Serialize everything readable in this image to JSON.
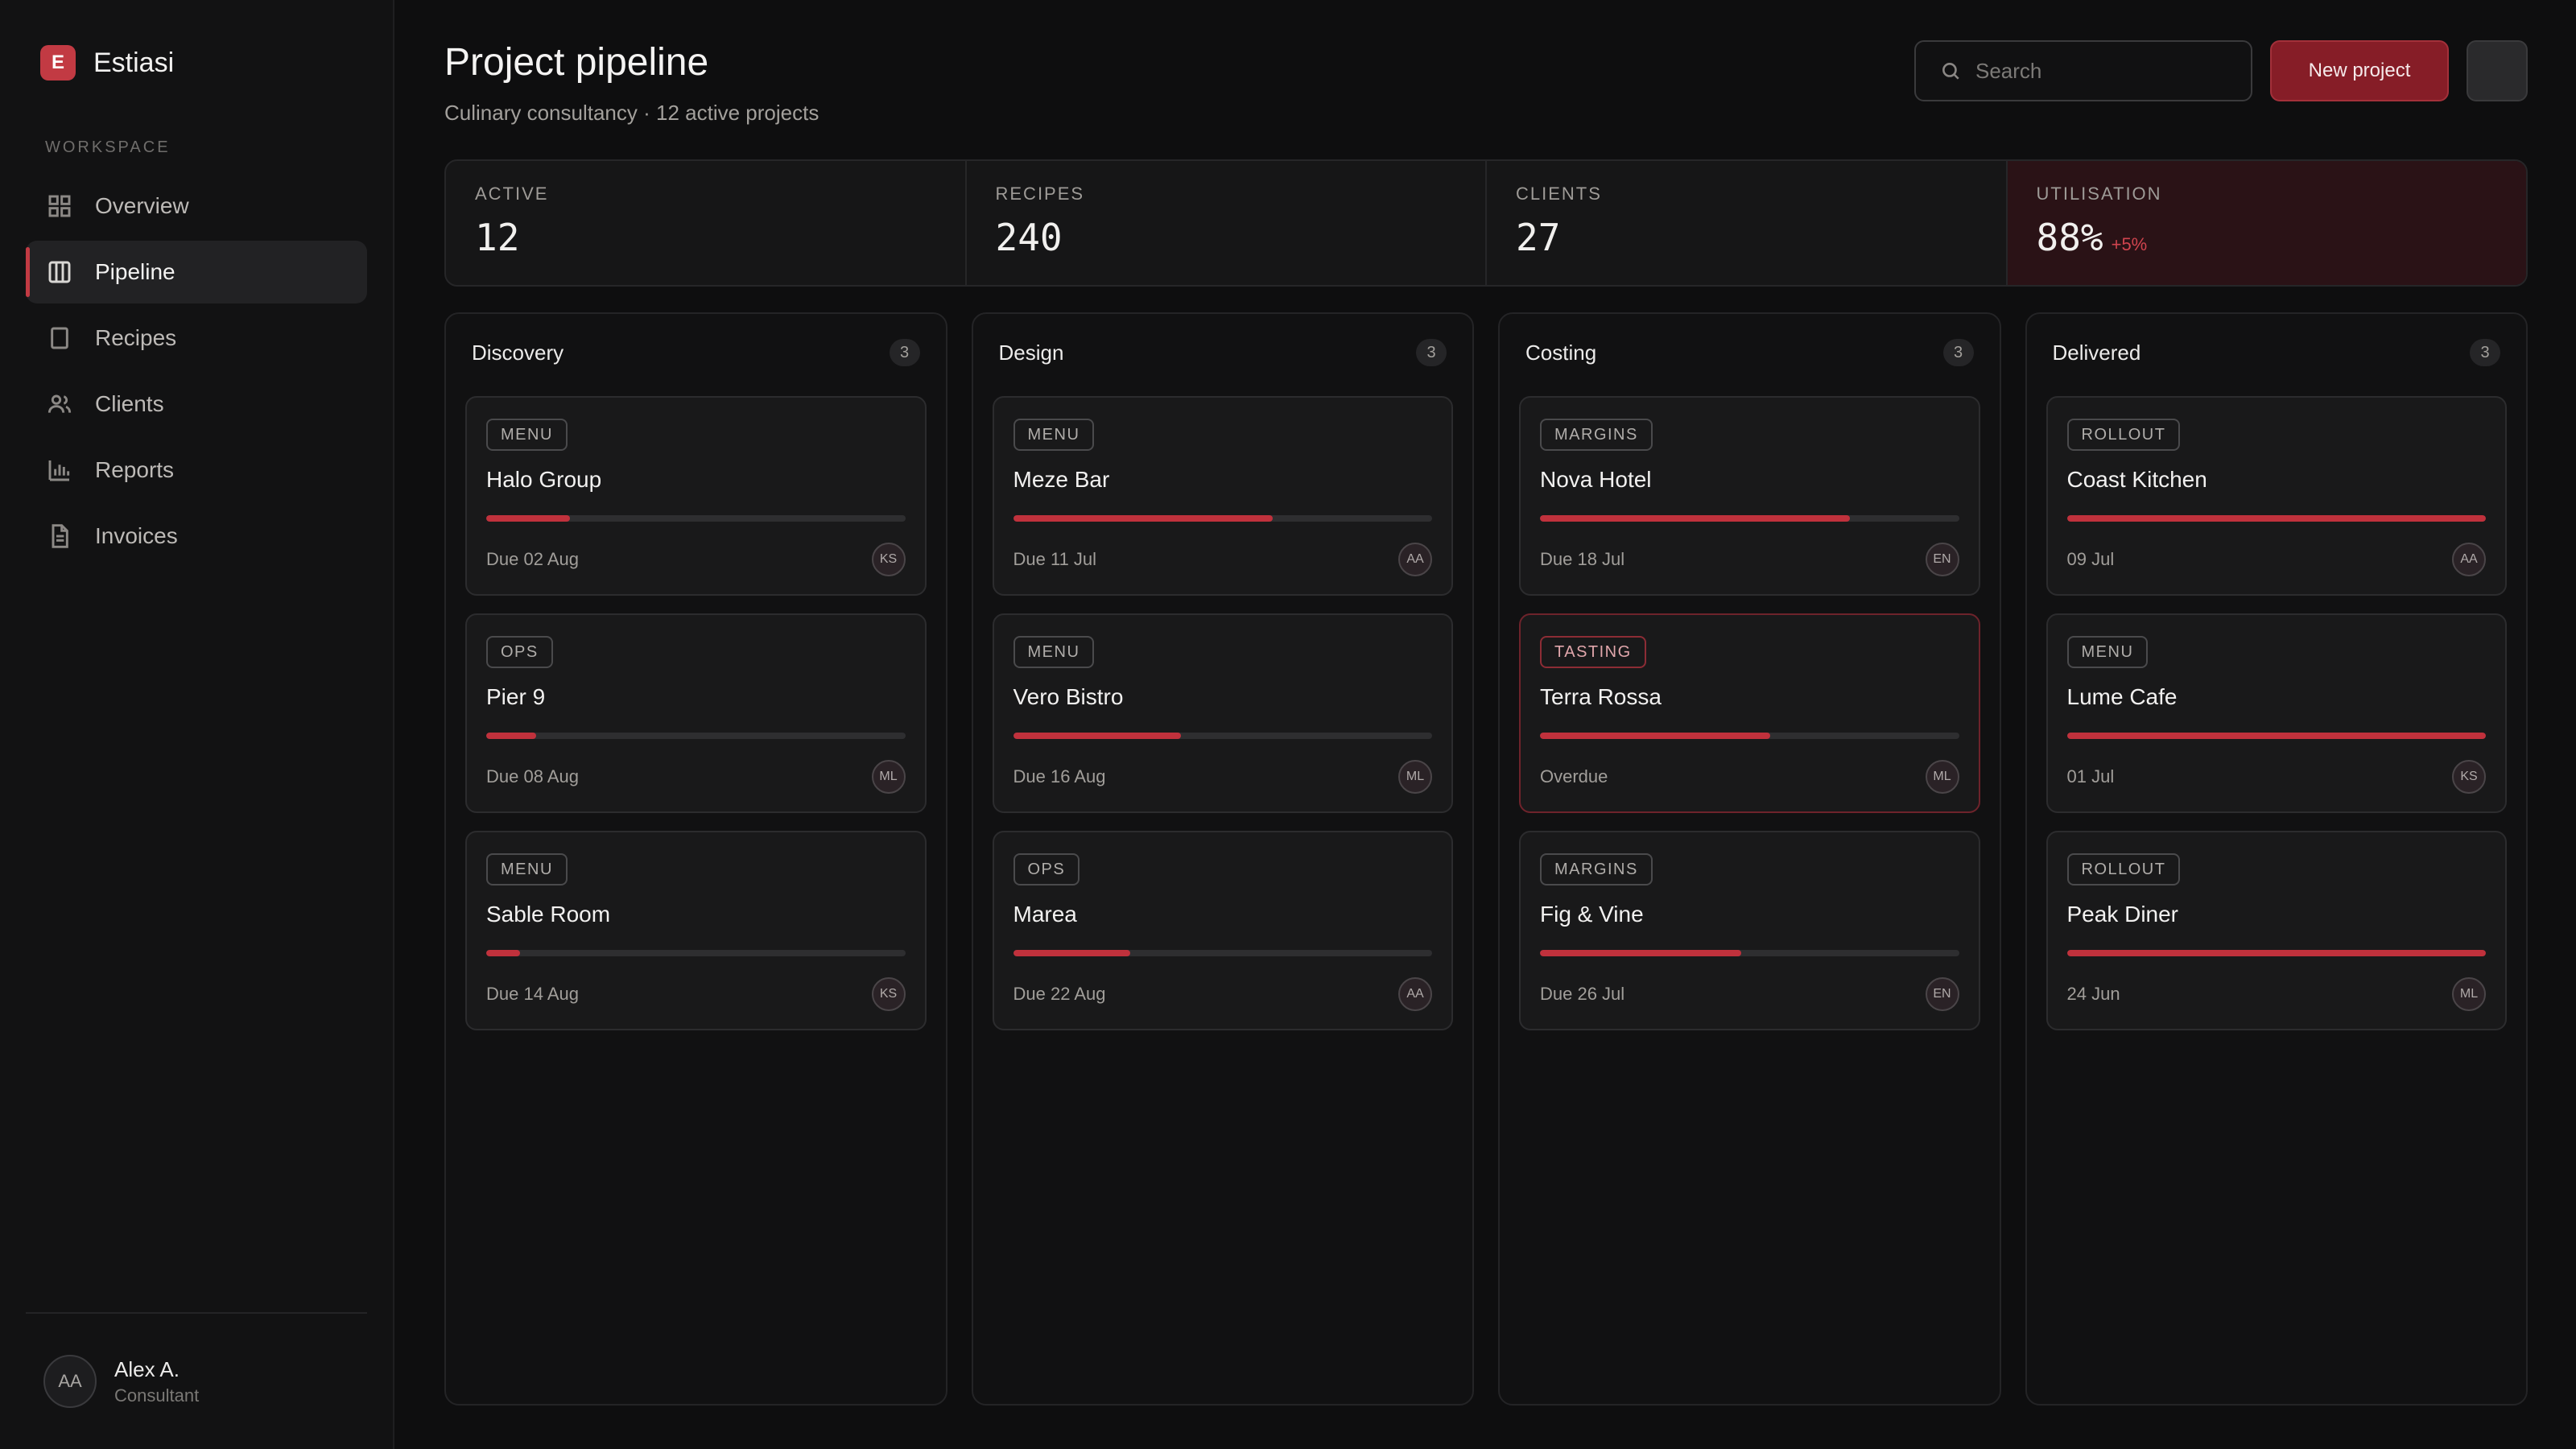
{
  "brand": {
    "logo_letter": "E",
    "name": "Estiasi"
  },
  "sidebar": {
    "section": "WORKSPACE",
    "items": [
      {
        "label": "Overview",
        "icon": "grid-icon",
        "active": false
      },
      {
        "label": "Pipeline",
        "icon": "columns-icon",
        "active": true
      },
      {
        "label": "Recipes",
        "icon": "book-icon",
        "active": false
      },
      {
        "label": "Clients",
        "icon": "users-icon",
        "active": false
      },
      {
        "label": "Reports",
        "icon": "bar-chart-icon",
        "active": false
      },
      {
        "label": "Invoices",
        "icon": "file-icon",
        "active": false
      }
    ],
    "user": {
      "initials": "AA",
      "name": "Alex A.",
      "role": "Consultant"
    }
  },
  "header": {
    "title": "Project pipeline",
    "subtitle": "Culinary consultancy · 12 active projects",
    "search_placeholder": "Search",
    "new_button": "New project"
  },
  "stats": [
    {
      "label": "ACTIVE",
      "value": "12",
      "delta": ""
    },
    {
      "label": "RECIPES",
      "value": "240",
      "delta": ""
    },
    {
      "label": "CLIENTS",
      "value": "27",
      "delta": ""
    },
    {
      "label": "UTILISATION",
      "value": "88%",
      "delta": "+5%"
    }
  ],
  "columns": [
    {
      "title": "Discovery",
      "count": "3",
      "cards": [
        {
          "tag": "MENU",
          "title": "Halo Group",
          "progress": 0.2,
          "due": "Due 02 Aug",
          "assignee": "KS",
          "alert": false
        },
        {
          "tag": "OPS",
          "title": "Pier 9",
          "progress": 0.12,
          "due": "Due 08 Aug",
          "assignee": "ML",
          "alert": false
        },
        {
          "tag": "MENU",
          "title": "Sable Room",
          "progress": 0.08,
          "due": "Due 14 Aug",
          "assignee": "KS",
          "alert": false
        }
      ]
    },
    {
      "title": "Design",
      "count": "3",
      "cards": [
        {
          "tag": "MENU",
          "title": "Meze Bar",
          "progress": 0.62,
          "due": "Due 11 Jul",
          "assignee": "AA",
          "alert": false
        },
        {
          "tag": "MENU",
          "title": "Vero Bistro",
          "progress": 0.4,
          "due": "Due 16 Aug",
          "assignee": "ML",
          "alert": false
        },
        {
          "tag": "OPS",
          "title": "Marea",
          "progress": 0.28,
          "due": "Due 22 Aug",
          "assignee": "AA",
          "alert": false
        }
      ]
    },
    {
      "title": "Costing",
      "count": "3",
      "cards": [
        {
          "tag": "MARGINS",
          "title": "Nova Hotel",
          "progress": 0.74,
          "due": "Due 18 Jul",
          "assignee": "EN",
          "alert": false
        },
        {
          "tag": "TASTING",
          "title": "Terra Rossa",
          "progress": 0.55,
          "due": "Overdue",
          "assignee": "ML",
          "alert": true
        },
        {
          "tag": "MARGINS",
          "title": "Fig & Vine",
          "progress": 0.48,
          "due": "Due 26 Jul",
          "assignee": "EN",
          "alert": false
        }
      ]
    },
    {
      "title": "Delivered",
      "count": "3",
      "cards": [
        {
          "tag": "ROLLOUT",
          "title": "Coast Kitchen",
          "progress": 1.0,
          "due": "09 Jul",
          "assignee": "AA",
          "alert": false
        },
        {
          "tag": "MENU",
          "title": "Lume Cafe",
          "progress": 1.0,
          "due": "01 Jul",
          "assignee": "KS",
          "alert": false
        },
        {
          "tag": "ROLLOUT",
          "title": "Peak Diner",
          "progress": 1.0,
          "due": "24 Jun",
          "assignee": "ML",
          "alert": false
        }
      ]
    }
  ],
  "colors": {
    "accent": "#c0313c",
    "button": "#861d27",
    "background": "#0e0e0f"
  }
}
